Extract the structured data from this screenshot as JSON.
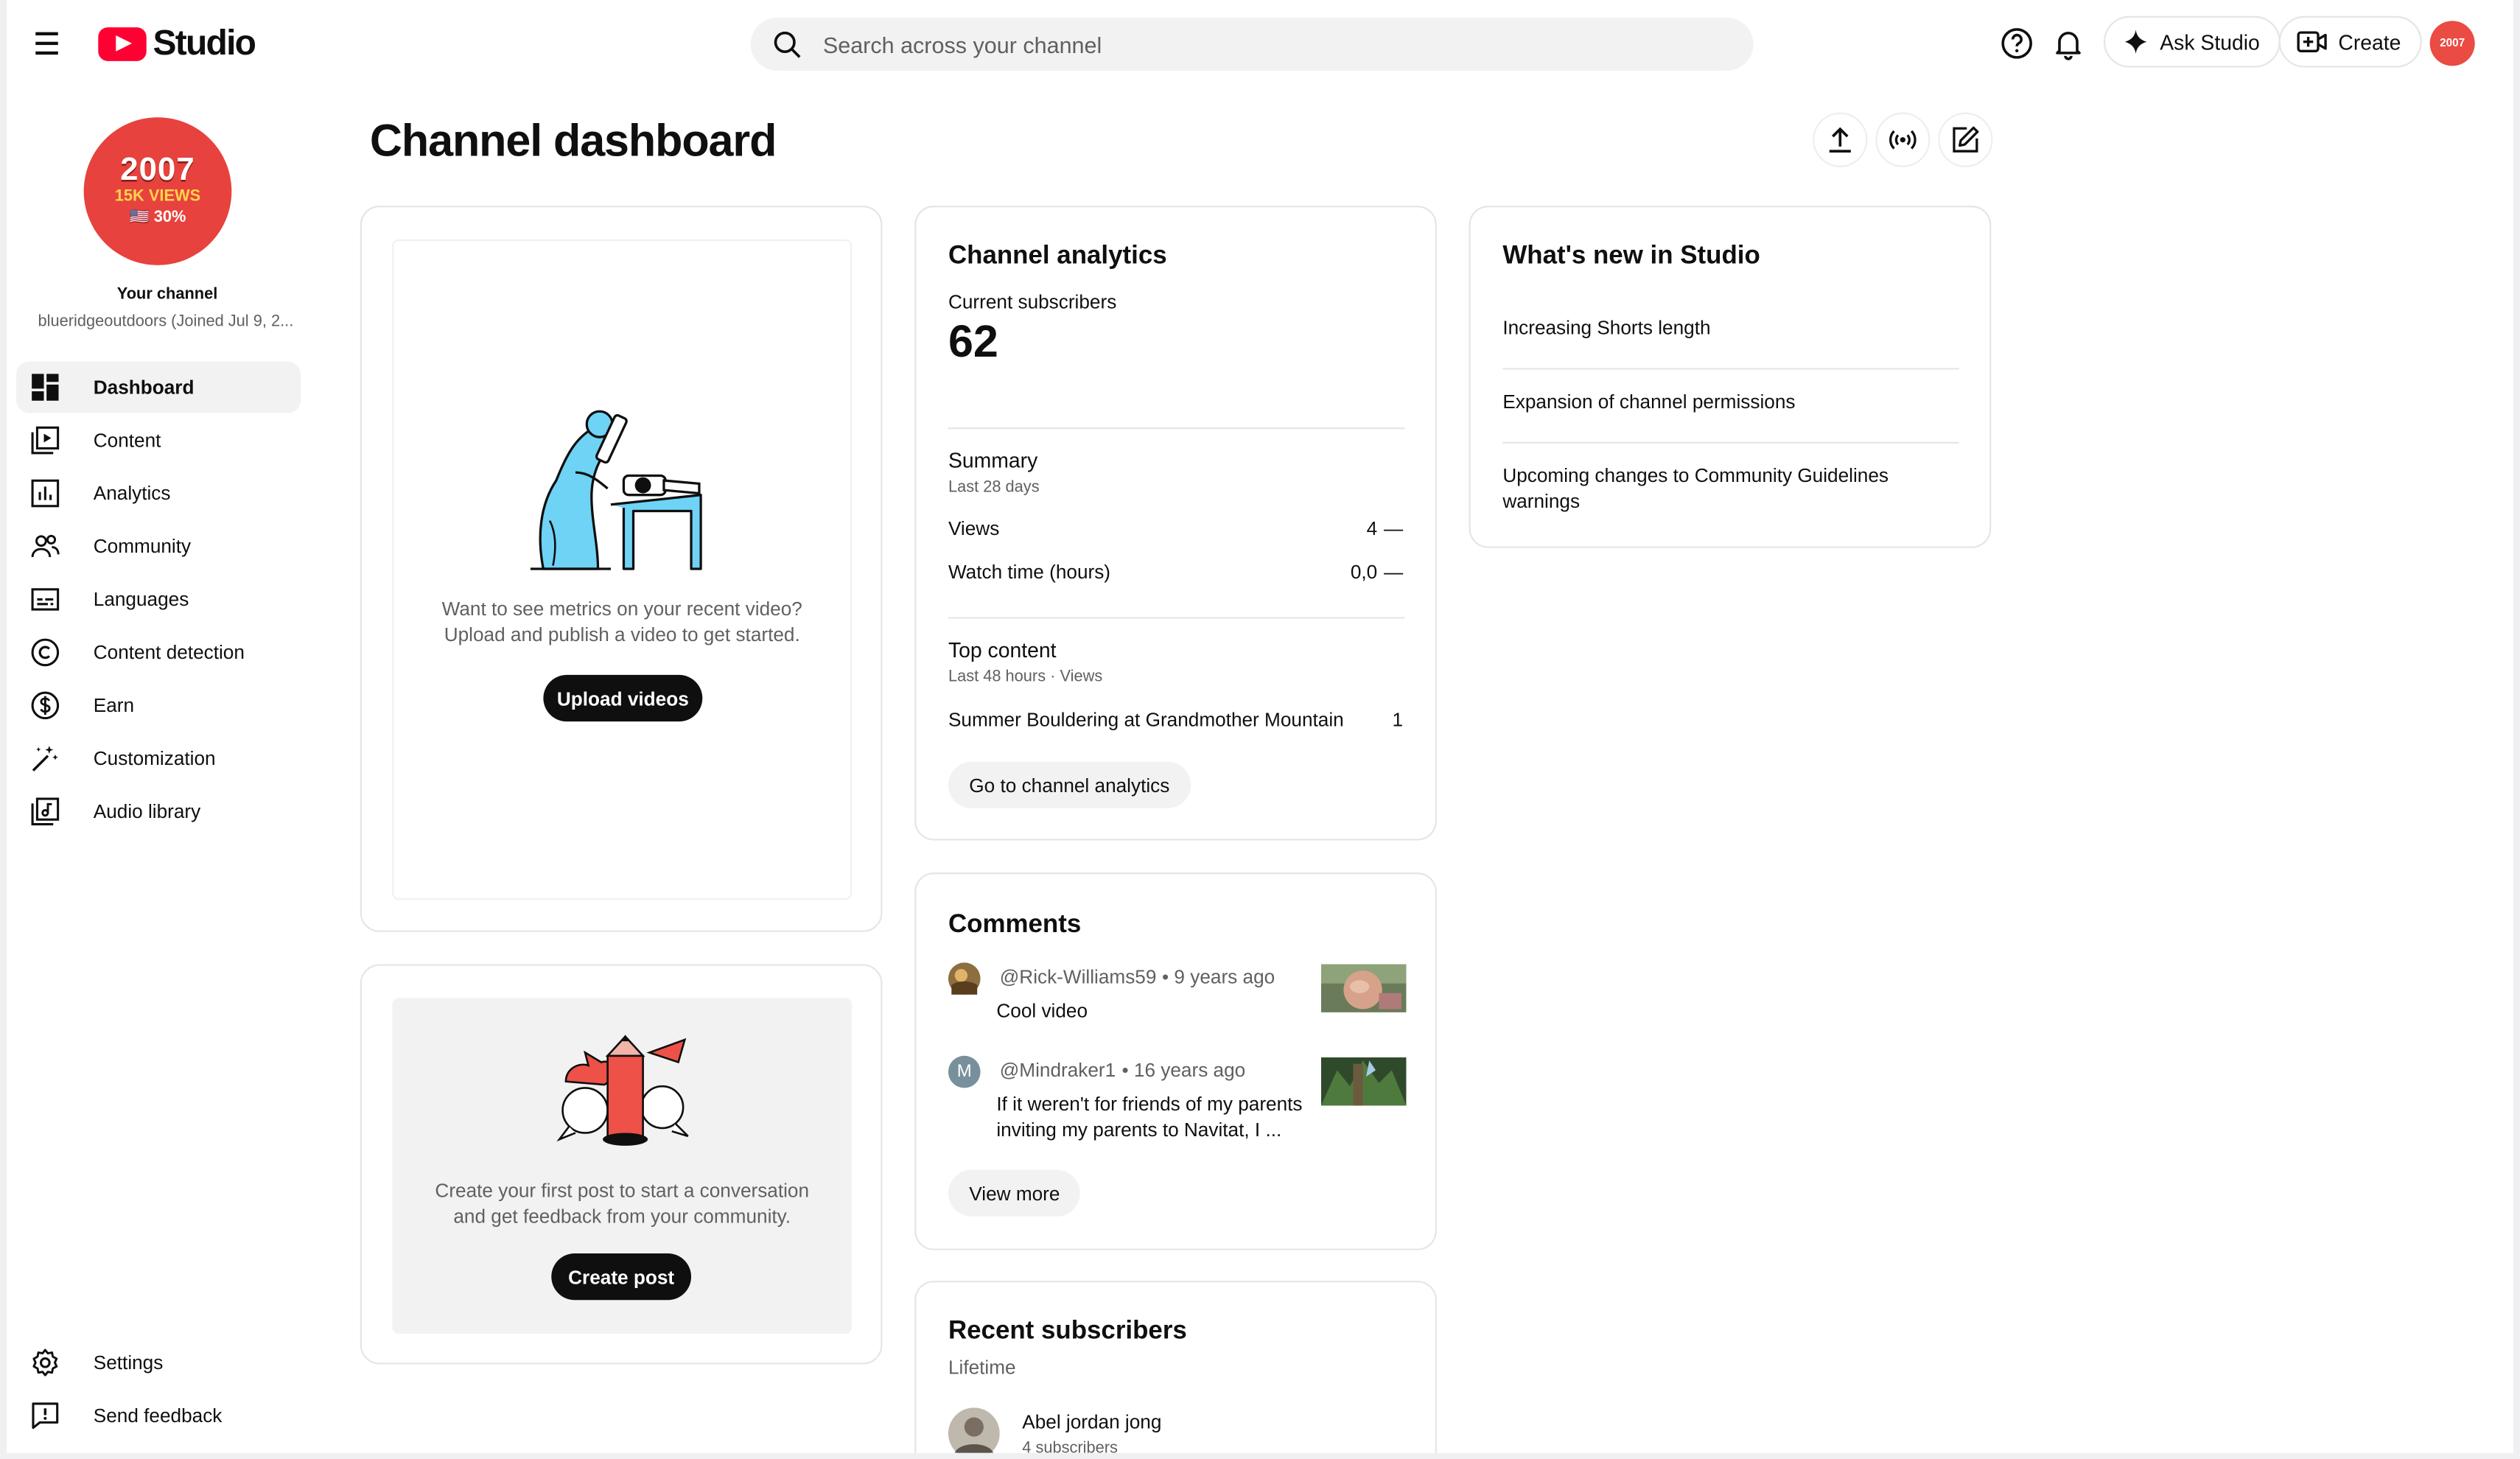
{
  "header": {
    "logo_text": "Studio",
    "search_placeholder": "Search across your channel",
    "ask_studio_label": "Ask Studio",
    "create_label": "Create",
    "avatar_text": "2007"
  },
  "channel": {
    "avatar_line1": "2007",
    "avatar_line2": "15K VIEWS",
    "avatar_line3": "🇺🇸 30%",
    "label": "Your channel",
    "handle": "blueridgeoutdoors (Joined Jul 9, 2..."
  },
  "sidebar": {
    "items": [
      {
        "label": "Dashboard",
        "icon": "dashboard-icon"
      },
      {
        "label": "Content",
        "icon": "content-icon"
      },
      {
        "label": "Analytics",
        "icon": "analytics-icon"
      },
      {
        "label": "Community",
        "icon": "community-icon"
      },
      {
        "label": "Languages",
        "icon": "languages-icon"
      },
      {
        "label": "Content detection",
        "icon": "copyright-icon"
      },
      {
        "label": "Earn",
        "icon": "dollar-icon"
      },
      {
        "label": "Customization",
        "icon": "magic-wand-icon"
      },
      {
        "label": "Audio library",
        "icon": "audio-library-icon"
      }
    ],
    "bottom": [
      {
        "label": "Settings",
        "icon": "gear-icon"
      },
      {
        "label": "Send feedback",
        "icon": "feedback-icon"
      }
    ]
  },
  "main": {
    "title": "Channel dashboard",
    "video_card": {
      "text_line1": "Want to see metrics on your recent video?",
      "text_line2": "Upload and publish a video to get started.",
      "button": "Upload videos"
    },
    "post_card": {
      "text_line1": "Create your first post to start a conversation",
      "text_line2": "and get feedback from your community.",
      "button": "Create post"
    },
    "analytics": {
      "title": "Channel analytics",
      "subs_label": "Current subscribers",
      "subs_value": "62",
      "summary_title": "Summary",
      "summary_period": "Last 28 days",
      "rows": [
        {
          "label": "Views",
          "value": "4",
          "trend": "—"
        },
        {
          "label": "Watch time (hours)",
          "value": "0,0",
          "trend": "—"
        }
      ],
      "top_title": "Top content",
      "top_period": "Last 48 hours · Views",
      "top_items": [
        {
          "title": "Summer Bouldering at Grandmother Mountain",
          "value": "1"
        }
      ],
      "button": "Go to channel analytics"
    },
    "comments": {
      "title": "Comments",
      "items": [
        {
          "author": "@Rick-Williams59",
          "time": "• 9 years ago",
          "text1": "Cool video",
          "text2": "",
          "initial": ""
        },
        {
          "author": "@Mindraker1",
          "time": "• 16 years ago",
          "text1": "If it weren't for friends of my parents",
          "text2": "inviting my parents to Navitat, I ...",
          "initial": "M"
        }
      ],
      "button": "View more"
    },
    "subscribers": {
      "title": "Recent subscribers",
      "period": "Lifetime",
      "items": [
        {
          "name": "Abel jordan jong",
          "subs": "4 subscribers"
        }
      ]
    },
    "whats_new": {
      "title": "What's new in Studio",
      "items": [
        {
          "line1": "Increasing Shorts length",
          "line2": ""
        },
        {
          "line1": "Expansion of channel permissions",
          "line2": ""
        },
        {
          "line1": "Upcoming changes to Community Guidelines",
          "line2": "warnings"
        }
      ]
    }
  },
  "colors": {
    "brand_red": "#ff0033",
    "avatar_red": "#e7423d",
    "illustration_blue": "#6fd3f5",
    "illustration_red": "#ee5148"
  }
}
